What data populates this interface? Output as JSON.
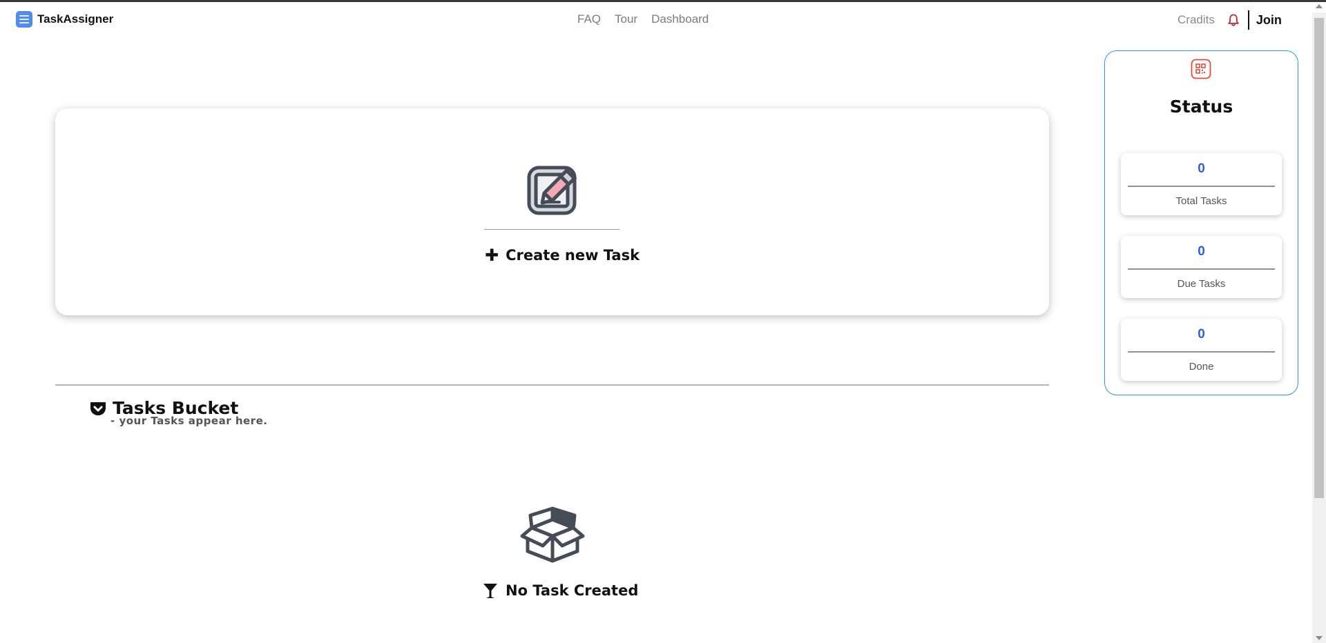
{
  "navbar": {
    "brand": "TaskAssigner",
    "links": [
      "FAQ",
      "Tour",
      "Dashboard"
    ],
    "credits": "Cradits",
    "join": "Join"
  },
  "create": {
    "label": "Create new Task"
  },
  "bucket": {
    "title": "Tasks Bucket",
    "subtitle": "- your Tasks appear here.",
    "empty_message": "No Task Created"
  },
  "status": {
    "title": "Status",
    "stats": [
      {
        "value": "0",
        "label": "Total Tasks"
      },
      {
        "value": "0",
        "label": "Due Tasks"
      },
      {
        "value": "0",
        "label": "Done"
      }
    ]
  },
  "colors": {
    "brand_blue": "#4f8cf0",
    "panel_border": "#2e9ad6",
    "stat_value": "#2f5fe0",
    "bell": "#c0262d",
    "qr_icon": "#e64a3c"
  }
}
